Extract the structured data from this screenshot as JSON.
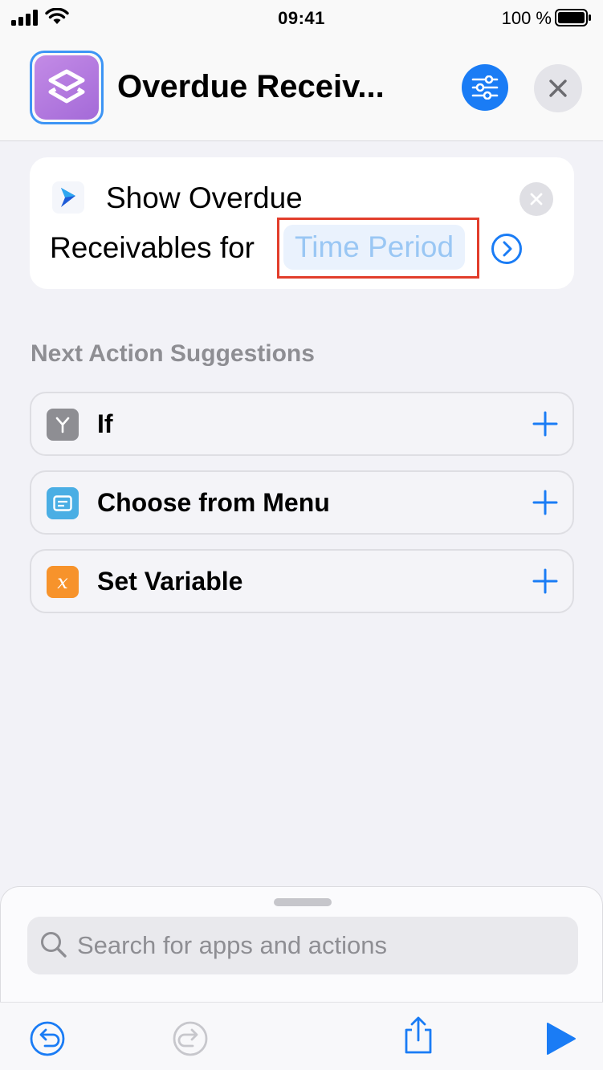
{
  "status_bar": {
    "time": "09:41",
    "battery_percent": "100 %"
  },
  "header": {
    "title": "Overdue Receiv...",
    "app_icon": "shortcuts-layers-icon",
    "settings_icon": "sliders-icon",
    "close_icon": "close-icon"
  },
  "action_card": {
    "icon": "dynamics-arrow-icon",
    "line1": "Show Overdue",
    "line2": "Receivables for",
    "parameter": "Time Period",
    "expand_icon": "chevron-right-circle-icon",
    "clear_icon": "clear-icon"
  },
  "suggestions": {
    "title": "Next Action Suggestions",
    "items": [
      {
        "label": "If",
        "icon": "branch-icon",
        "color": "#8e8e93"
      },
      {
        "label": "Choose from Menu",
        "icon": "menu-icon",
        "color": "#4aaee4"
      },
      {
        "label": "Set Variable",
        "icon": "variable-x-icon",
        "color": "#f7932b"
      }
    ]
  },
  "search": {
    "placeholder": "Search for apps and actions"
  },
  "toolbar": {
    "undo_icon": "undo-icon",
    "redo_icon": "redo-icon",
    "share_icon": "share-icon",
    "run_icon": "play-icon"
  },
  "colors": {
    "accent": "#1a7cf5",
    "highlight_border": "#e23d2b",
    "parameter_text": "#9ac7f4"
  }
}
